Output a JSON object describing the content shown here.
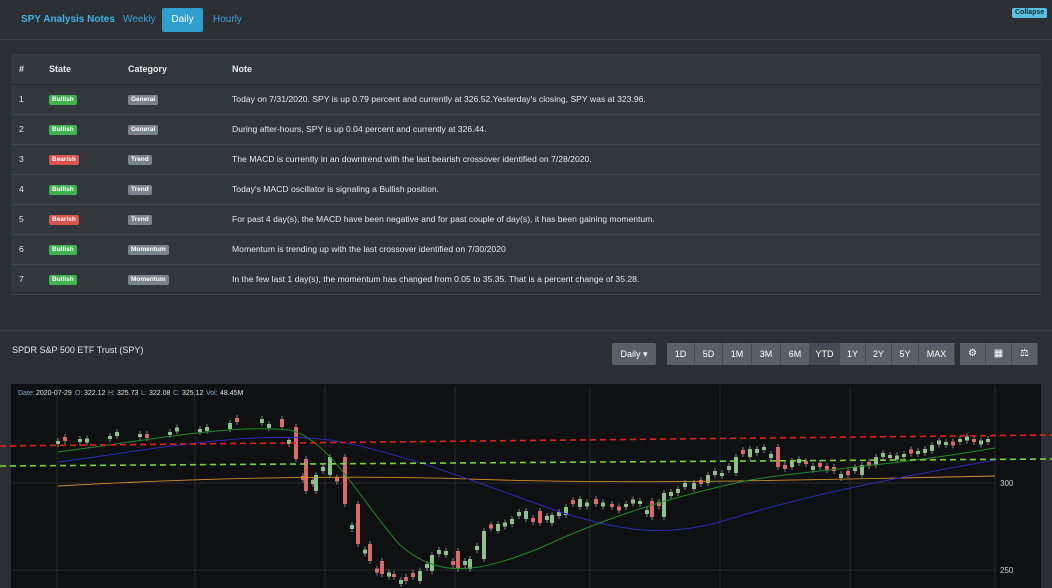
{
  "header": {
    "brand": "SPY Analysis Notes",
    "tabs": [
      "Weekly",
      "Daily",
      "Hourly"
    ],
    "active_tab": "Daily",
    "collapse_label": "Collapse"
  },
  "notes": {
    "headers": [
      "#",
      "State",
      "Category",
      "Note"
    ],
    "rows": [
      {
        "num": "1",
        "state": "Bullish",
        "category": "General",
        "note": "Today on 7/31/2020. SPY is up 0.79 percent and currently at 326.52.Yesterday's closing, SPY was at 323.96."
      },
      {
        "num": "2",
        "state": "Bullish",
        "category": "General",
        "note": "During after-hours, SPY is up 0.04 percent and currently at 326.44."
      },
      {
        "num": "3",
        "state": "Bearish",
        "category": "Trend",
        "note": "The MACD is currently in an downtrend with the last bearish crossover identified on 7/28/2020."
      },
      {
        "num": "4",
        "state": "Bullish",
        "category": "Trend",
        "note": "Today's MACD oscillator is signaling a Bullish position."
      },
      {
        "num": "5",
        "state": "Bearish",
        "category": "Trend",
        "note": "For past 4 day(s), the MACD have been negative and for past couple of day(s), it has been gaining momentum."
      },
      {
        "num": "6",
        "state": "Bullish",
        "category": "Momentum",
        "note": "Momentum is trending up with the last crossover identified on 7/30/2020"
      },
      {
        "num": "7",
        "state": "Bullish",
        "category": "Momentum",
        "note": "In the few last 1 day(s), the momentum has changed from 0.05 to 35.35. That is a percent change of 35.28."
      }
    ]
  },
  "chart": {
    "title": "SPDR S&P 500 ETF Trust (SPY)",
    "interval_label": "Daily",
    "ranges": [
      "1D",
      "5D",
      "1M",
      "3M",
      "6M",
      "YTD",
      "1Y",
      "2Y",
      "5Y",
      "MAX"
    ],
    "active_range": "YTD",
    "tool_icons": [
      "settings-icon",
      "calculator-icon",
      "balance-scale-icon"
    ],
    "info": {
      "date_label": "Date:",
      "date": "2020-07-29",
      "open_label": "O:",
      "open": "322.12",
      "high_label": "H:",
      "high": "325.73",
      "low_label": "L:",
      "low": "322.08",
      "close_label": "C:",
      "close": "325.12",
      "vol_label": "Vol:",
      "vol": "48.45M"
    },
    "y_ticks": [
      "300",
      "250"
    ],
    "colors": {
      "up": "#8fbf8f",
      "down": "#d96a6a",
      "resistance": "#e02020",
      "support": "#7ad33a",
      "ma_green": "#1f8a2a",
      "ma_blue": "#2a2ab8",
      "ma_orange": "#d0902a"
    }
  }
}
